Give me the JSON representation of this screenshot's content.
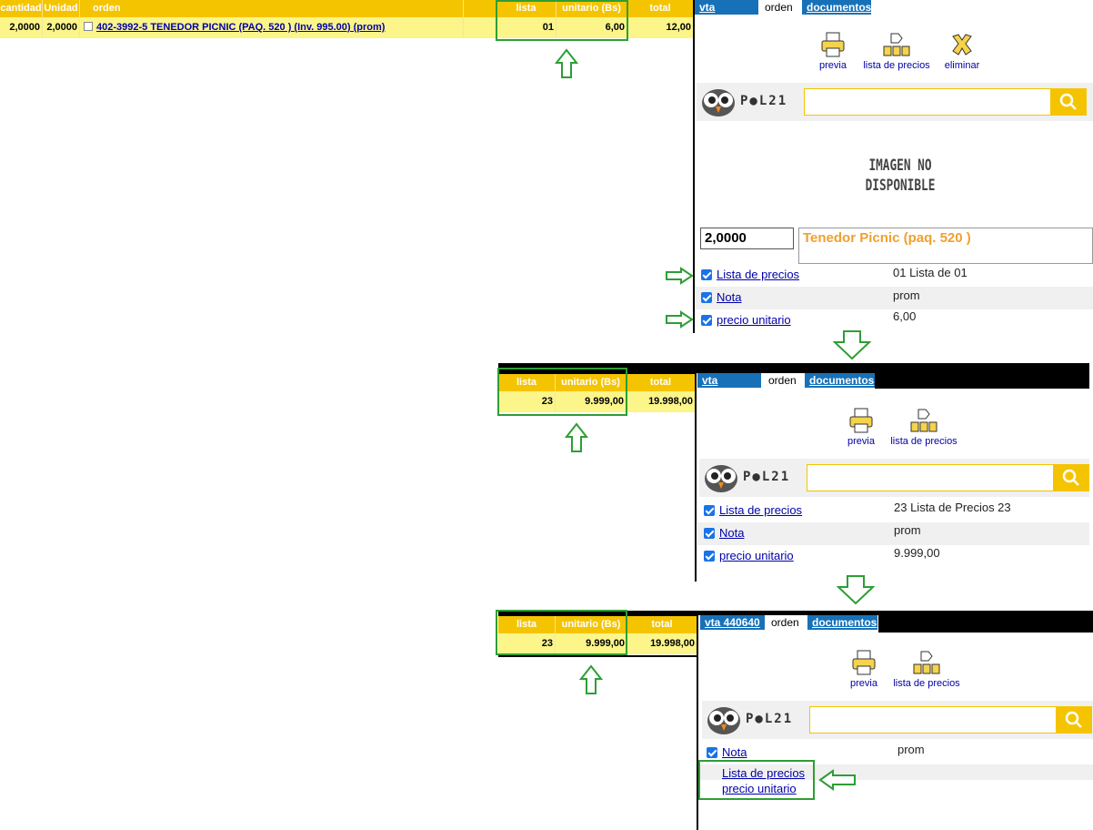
{
  "grid": {
    "headers": {
      "cantidad": "cantidad",
      "unidad": "Unidad",
      "orden": "orden",
      "lista": "lista",
      "unitario": "unitario (Bs)",
      "total": "total"
    },
    "row": {
      "cantidad": "2,0000",
      "unidad": "2,0000",
      "orden": "402-3992-5 TENEDOR PICNIC (PAQ. 520 ) (Inv. 995.00) (prom)",
      "lista": "01",
      "unitario": "6,00",
      "total": "12,00"
    }
  },
  "panel": {
    "tabs": {
      "sale": "vta 440640",
      "order": "orden",
      "docs": "documentos"
    },
    "tools": {
      "preview": "previa",
      "price_list": "lista de precios",
      "delete": "eliminar"
    },
    "logo": "P●L21",
    "image_placeholder": [
      "IMAGEN NO",
      "DISPONIBLE"
    ],
    "quantity": "2,0000",
    "description": "Tenedor Picnic (paq. 520 )",
    "props": {
      "price_list_label": "Lista de precios",
      "note_label": "Nota",
      "unit_price_label": "precio unitario",
      "price_list_value": "01 Lista de 01",
      "note_value": "prom",
      "unit_price_value": "6,00"
    }
  },
  "step2": {
    "headers": {
      "lista": "lista",
      "unitario": "unitario (Bs)",
      "total": "total"
    },
    "row": {
      "lista": "23",
      "unitario": "9.999,00",
      "total": "19.998,00"
    },
    "props": {
      "price_list_value": "23 Lista de Precios 23",
      "note_value": "prom",
      "unit_price_value": "9.999,00"
    }
  },
  "step3": {
    "row": {
      "lista": "23",
      "unitario": "9.999,00",
      "total": "19.998,00"
    },
    "props": {
      "note_value": "prom"
    }
  },
  "colors": {
    "accent": "#f5c400",
    "row": "#fbf58a",
    "tab": "#1771b8",
    "annotation": "#2e9e35"
  }
}
